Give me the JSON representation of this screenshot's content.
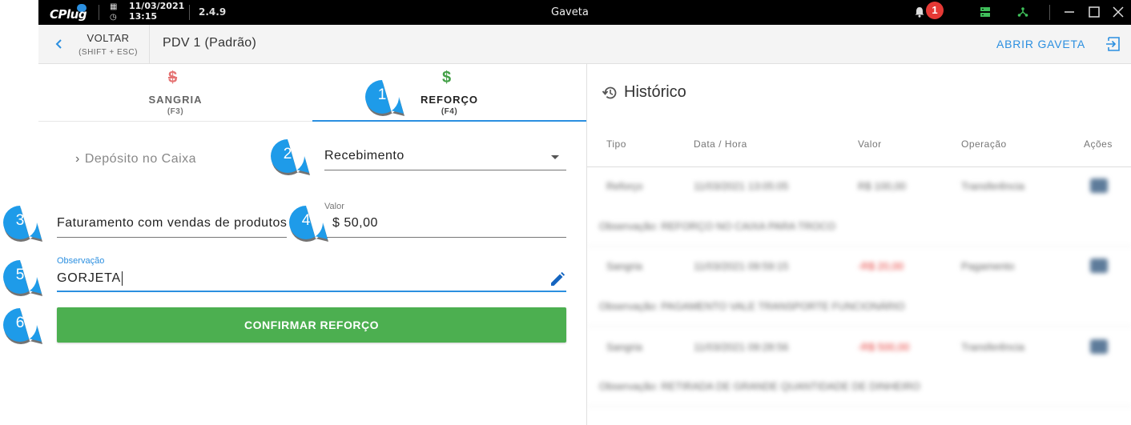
{
  "titlebar": {
    "logo": "CPlug",
    "date": "11/03/2021",
    "time": "13:15",
    "version": "2.4.9",
    "window_title": "Gaveta",
    "notification_count": "1"
  },
  "header": {
    "back_label": "VOLTAR",
    "back_hint": "(SHIFT + ESC)",
    "title": "PDV 1 (Padrão)",
    "open_drawer_label": "ABRIR GAVETA"
  },
  "tabs": [
    {
      "icon": "$",
      "label": "SANGRIA",
      "hint": "(F3)",
      "icon_color": "#e57373"
    },
    {
      "icon": "$",
      "label": "REFORÇO",
      "hint": "(F4)",
      "icon_color": "#43a047"
    }
  ],
  "form": {
    "deposit_label": "Depósito no Caixa",
    "type_select": "Recebimento",
    "description": "Faturamento com vendas de produtos",
    "valor_label": "Valor",
    "valor_value": "$  50,00",
    "obs_label": "Observação",
    "obs_value": "GORJETA",
    "confirm_label": "CONFIRMAR REFORÇO"
  },
  "historico": {
    "title": "Histórico",
    "columns": [
      "Tipo",
      "Data / Hora",
      "Valor",
      "Operação",
      "Ações"
    ],
    "rows": [
      {
        "tipo": "Reforço",
        "data": "11/03/2021 13:05:05",
        "valor": "R$ 100,00",
        "operacao": "Transferência",
        "obs": "Observação: REFORÇO NO CAIXA PARA TROCO",
        "negative": false
      },
      {
        "tipo": "Sangria",
        "data": "11/03/2021 09:59:15",
        "valor": "-R$ 20,00",
        "operacao": "Pagamento",
        "obs": "Observação: PAGAMENTO VALE TRANSPORTE FUNCIONÁRIO",
        "negative": true
      },
      {
        "tipo": "Sangria",
        "data": "11/03/2021 09:28:56",
        "valor": "-R$ 500,00",
        "operacao": "Transferência",
        "obs": "Observação: RETIRADA DE GRANDE QUANTIDADE DE DINHEIRO",
        "negative": true
      }
    ]
  },
  "callouts": [
    "1",
    "2",
    "3",
    "4",
    "5",
    "6"
  ],
  "colors": {
    "accent": "#2b8fe0",
    "confirm": "#4caf50",
    "callout": "#1e9be9",
    "badge": "#e53935"
  }
}
